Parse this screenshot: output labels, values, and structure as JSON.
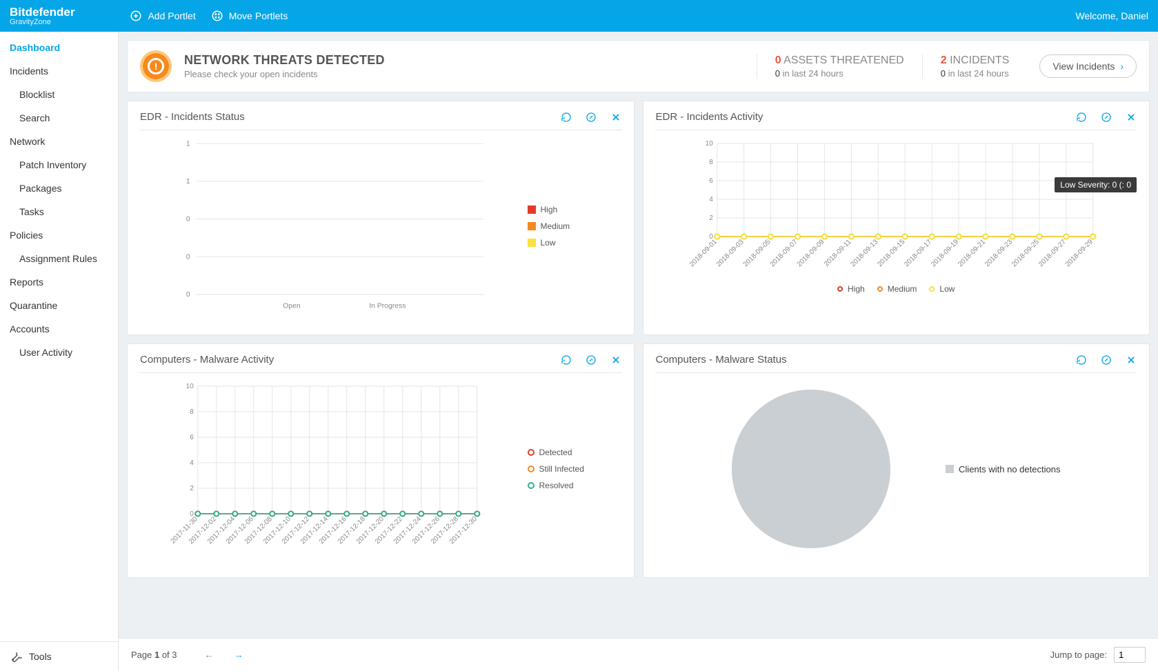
{
  "brand": {
    "name": "Bitdefender",
    "sub": "GravityZone"
  },
  "topbar": {
    "add": "Add Portlet",
    "move": "Move Portlets",
    "welcome": "Welcome, Daniel"
  },
  "sidebar": {
    "tools": "Tools",
    "items": [
      {
        "label": "Dashboard",
        "sub": false,
        "active": true
      },
      {
        "label": "Incidents",
        "sub": false
      },
      {
        "label": "Blocklist",
        "sub": true
      },
      {
        "label": "Search",
        "sub": true
      },
      {
        "label": "Network",
        "sub": false
      },
      {
        "label": "Patch Inventory",
        "sub": true
      },
      {
        "label": "Packages",
        "sub": true
      },
      {
        "label": "Tasks",
        "sub": true
      },
      {
        "label": "Policies",
        "sub": false
      },
      {
        "label": "Assignment Rules",
        "sub": true
      },
      {
        "label": "Reports",
        "sub": false
      },
      {
        "label": "Quarantine",
        "sub": false
      },
      {
        "label": "Accounts",
        "sub": false
      },
      {
        "label": "User Activity",
        "sub": true
      }
    ]
  },
  "banner": {
    "title": "NETWORK THREATS DETECTED",
    "sub": "Please check your open incidents",
    "stat1": {
      "num": "0",
      "label": "ASSETS THREATENED",
      "bnum": "0",
      "blabel": "in last 24 hours"
    },
    "stat2": {
      "num": "2",
      "label": "INCIDENTS",
      "bnum": "0",
      "blabel": "in last 24 hours"
    },
    "view": "View Incidents"
  },
  "portlets": {
    "p1": {
      "title": "EDR - Incidents Status"
    },
    "p2": {
      "title": "EDR - Incidents Activity",
      "tooltip": "Low Severity: 0 (: 0"
    },
    "p3": {
      "title": "Computers - Malware Activity"
    },
    "p4": {
      "title": "Computers - Malware Status",
      "legend": "Clients with no detections"
    }
  },
  "legends": {
    "sev": [
      {
        "l": "High",
        "c": "#e23a2a"
      },
      {
        "l": "Medium",
        "c": "#f58a1f"
      },
      {
        "l": "Low",
        "c": "#f7e23e"
      }
    ],
    "malware": [
      {
        "l": "Detected",
        "c": "#e23a2a"
      },
      {
        "l": "Still Infected",
        "c": "#f58a1f"
      },
      {
        "l": "Resolved",
        "c": "#2fae8f"
      }
    ]
  },
  "footer": {
    "page_pre": "Page ",
    "page_b": "1",
    "page_post": " of 3",
    "jump": "Jump to page:",
    "jval": "1"
  },
  "chart_data": [
    {
      "id": "edr-status",
      "type": "bar",
      "title": "EDR - Incidents Status",
      "categories": [
        "Open",
        "In Progress"
      ],
      "series": [
        {
          "name": "High",
          "values": [
            0,
            0
          ]
        },
        {
          "name": "Medium",
          "values": [
            0,
            0
          ]
        },
        {
          "name": "Low",
          "values": [
            0,
            0
          ]
        }
      ],
      "ylim": [
        0,
        1
      ],
      "yticks": [
        0,
        0,
        0,
        1,
        1
      ]
    },
    {
      "id": "edr-activity",
      "type": "line",
      "title": "EDR - Incidents Activity",
      "x": [
        "2018-09-01",
        "2018-09-03",
        "2018-09-05",
        "2018-09-07",
        "2018-09-09",
        "2018-09-11",
        "2018-09-13",
        "2018-09-15",
        "2018-09-17",
        "2018-09-19",
        "2018-09-21",
        "2018-09-23",
        "2018-09-25",
        "2018-09-27",
        "2018-09-29"
      ],
      "series": [
        {
          "name": "High",
          "values": [
            0,
            0,
            0,
            0,
            0,
            0,
            0,
            0,
            0,
            0,
            0,
            0,
            0,
            0,
            0
          ]
        },
        {
          "name": "Medium",
          "values": [
            0,
            0,
            0,
            0,
            0,
            0,
            0,
            0,
            0,
            0,
            0,
            0,
            0,
            0,
            0
          ]
        },
        {
          "name": "Low",
          "values": [
            0,
            0,
            0,
            0,
            0,
            0,
            0,
            0,
            0,
            0,
            0,
            0,
            0,
            0,
            0
          ]
        }
      ],
      "ylim": [
        0,
        10
      ],
      "yticks": [
        0,
        2,
        4,
        6,
        8,
        10
      ]
    },
    {
      "id": "malware-activity",
      "type": "line",
      "title": "Computers - Malware Activity",
      "x": [
        "2017-11-30",
        "2017-12-02",
        "2017-12-04",
        "2017-12-06",
        "2017-12-08",
        "2017-12-10",
        "2017-12-12",
        "2017-12-14",
        "2017-12-16",
        "2017-12-18",
        "2017-12-20",
        "2017-12-22",
        "2017-12-24",
        "2017-12-26",
        "2017-12-28",
        "2017-12-30"
      ],
      "series": [
        {
          "name": "Detected",
          "values": [
            0,
            0,
            0,
            0,
            0,
            0,
            0,
            0,
            0,
            0,
            0,
            0,
            0,
            0,
            0,
            0
          ]
        },
        {
          "name": "Still Infected",
          "values": [
            0,
            0,
            0,
            0,
            0,
            0,
            0,
            0,
            0,
            0,
            0,
            0,
            0,
            0,
            0,
            0
          ]
        },
        {
          "name": "Resolved",
          "values": [
            0,
            0,
            0,
            0,
            0,
            0,
            0,
            0,
            0,
            0,
            0,
            0,
            0,
            0,
            0,
            0
          ]
        }
      ],
      "ylim": [
        0,
        10
      ],
      "yticks": [
        0,
        2,
        4,
        6,
        8,
        10
      ]
    },
    {
      "id": "malware-status",
      "type": "pie",
      "title": "Computers - Malware Status",
      "categories": [
        "Clients with no detections"
      ],
      "values": [
        100
      ]
    }
  ]
}
